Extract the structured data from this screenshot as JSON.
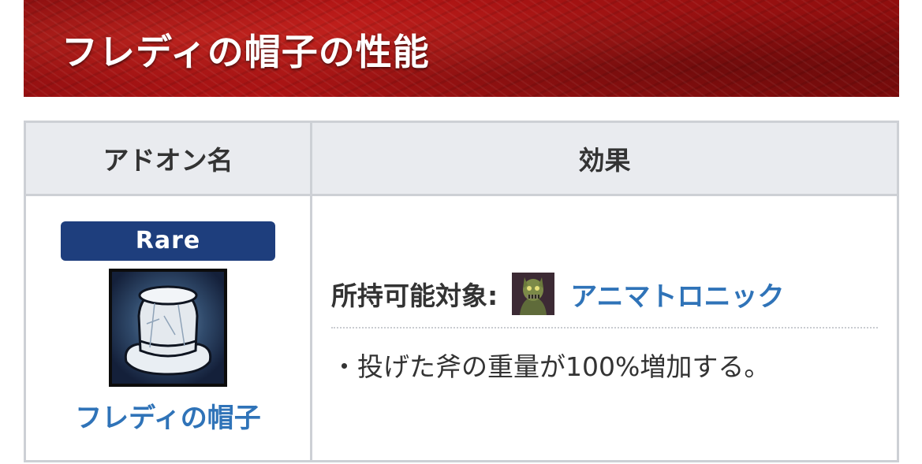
{
  "header": {
    "title": "フレディの帽子の性能"
  },
  "table": {
    "columns": [
      "アドオン名",
      "効果"
    ],
    "addon": {
      "rarity": "Rare",
      "icon": "top-hat-icon",
      "name": "フレディの帽子"
    },
    "effect": {
      "owner_label": "所持可能対象:",
      "owner_icon": "animatronic-portrait-icon",
      "owner_name": "アニマトロニック",
      "description": "・投げた斧の重量が100%増加する。"
    }
  },
  "colors": {
    "header_red": "#a81414",
    "rarity_blue": "#1e3e7d",
    "link_blue": "#2f73b8",
    "table_header_bg": "#e9ebef",
    "border": "#cdd0d5"
  }
}
